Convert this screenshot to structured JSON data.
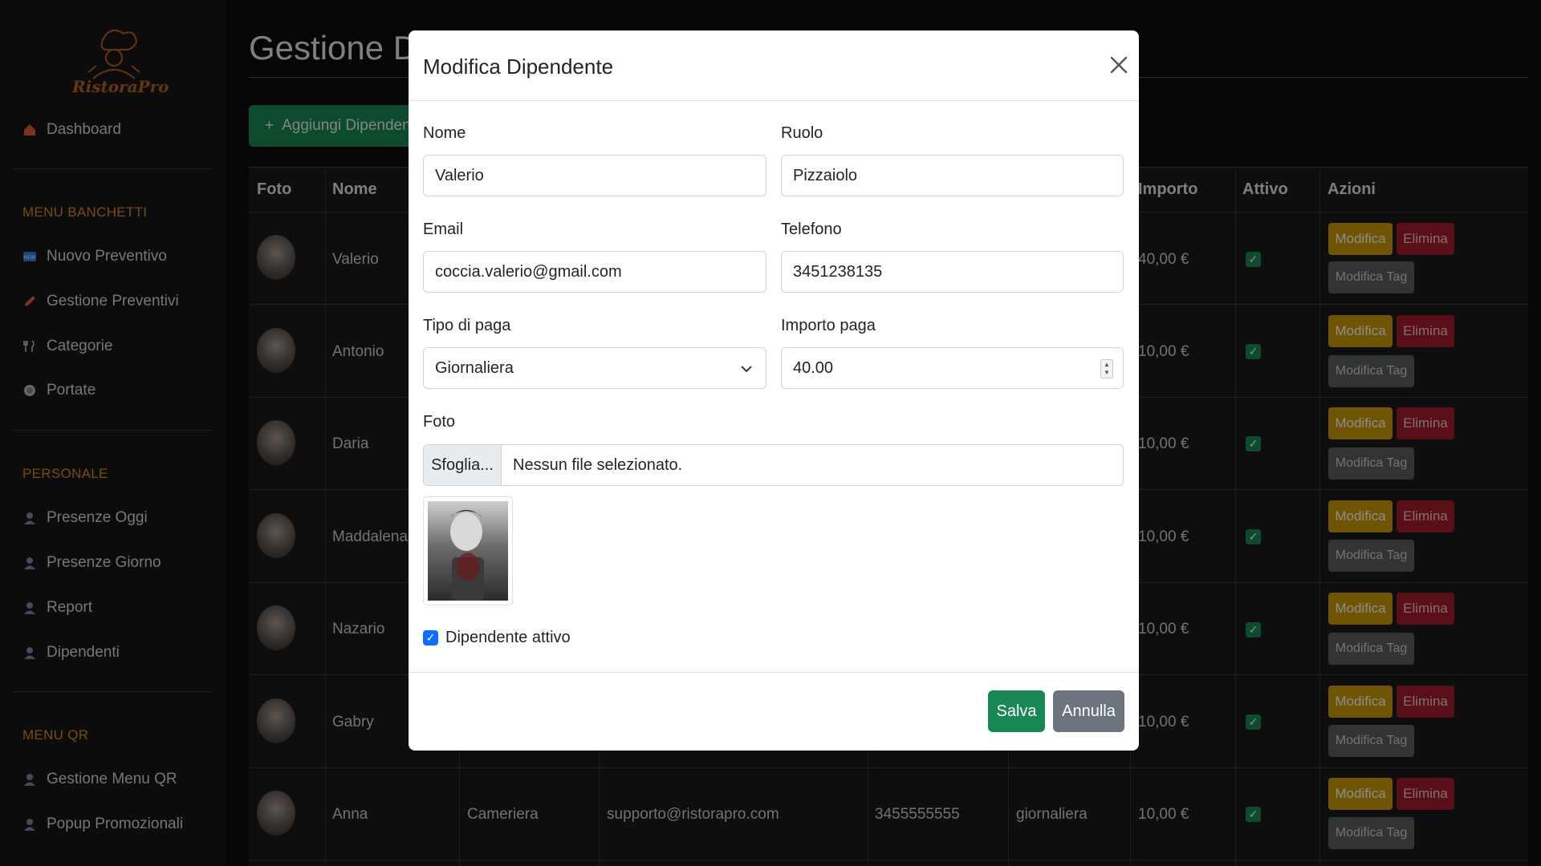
{
  "brand": {
    "logo_text": "RistoraPro"
  },
  "sidebar": {
    "dashboard": "Dashboard",
    "sections": {
      "banchetti": "MENU BANCHETTI",
      "personale": "PERSONALE",
      "qr": "MENU QR"
    },
    "banchetti_items": [
      {
        "label": "Nuovo Preventivo",
        "icon": "new-badge-icon"
      },
      {
        "label": "Gestione Preventivi",
        "icon": "pencil-icon"
      },
      {
        "label": "Categorie",
        "icon": "fork-knife-icon"
      },
      {
        "label": "Portate",
        "icon": "plate-icon"
      }
    ],
    "personale_items": [
      {
        "label": "Presenze Oggi",
        "icon": "user-icon"
      },
      {
        "label": "Presenze Giorno",
        "icon": "user-icon"
      },
      {
        "label": "Report",
        "icon": "user-icon"
      },
      {
        "label": "Dipendenti",
        "icon": "user-icon"
      }
    ],
    "qr_items": [
      {
        "label": "Gestione Menu QR",
        "icon": "user-icon"
      },
      {
        "label": "Popup Promozionali",
        "icon": "user-icon"
      }
    ]
  },
  "page": {
    "title": "Gestione Dip",
    "add_button": "Aggiungi Dipenden"
  },
  "table": {
    "headers": {
      "foto": "Foto",
      "nome": "Nome",
      "importo": "Importo",
      "attivo": "Attivo",
      "azioni": "Azioni"
    },
    "rows": [
      {
        "name": "Valerio",
        "importo": "40,00 €"
      },
      {
        "name": "Antonio",
        "importo": "10,00 €"
      },
      {
        "name": "Daria",
        "importo": "10,00 €"
      },
      {
        "name": "Maddalena",
        "importo": "10,00 €"
      },
      {
        "name": "Nazario",
        "importo": "10,00 €"
      },
      {
        "name": "Gabry",
        "importo": "10,00 €"
      },
      {
        "name": "Anna",
        "ruolo": "Cameriera",
        "email": "supporto@ristorapro.com",
        "telefono": "3455555555",
        "tipo": "giornaliera",
        "importo": "10,00 €"
      }
    ],
    "actions": {
      "modifica": "Modifica",
      "elimina": "Elimina",
      "modifica_tag": "Modifica Tag"
    }
  },
  "modal": {
    "title": "Modifica Dipendente",
    "fields": {
      "nome": {
        "label": "Nome",
        "value": "Valerio"
      },
      "ruolo": {
        "label": "Ruolo",
        "value": "Pizzaiolo"
      },
      "email": {
        "label": "Email",
        "value": "coccia.valerio@gmail.com"
      },
      "telefono": {
        "label": "Telefono",
        "value": "3451238135"
      },
      "tipo_paga": {
        "label": "Tipo di paga",
        "value": "Giornaliera"
      },
      "importo_paga": {
        "label": "Importo paga",
        "value": "40.00"
      },
      "foto": {
        "label": "Foto",
        "button": "Sfoglia...",
        "status": "Nessun file selezionato."
      }
    },
    "active_label": "Dipendente attivo",
    "save": "Salva",
    "cancel": "Annulla"
  },
  "colors": {
    "accent_orange": "#d98a1c",
    "success": "#198754",
    "warning": "#c89a06",
    "danger": "#a31d2b"
  }
}
